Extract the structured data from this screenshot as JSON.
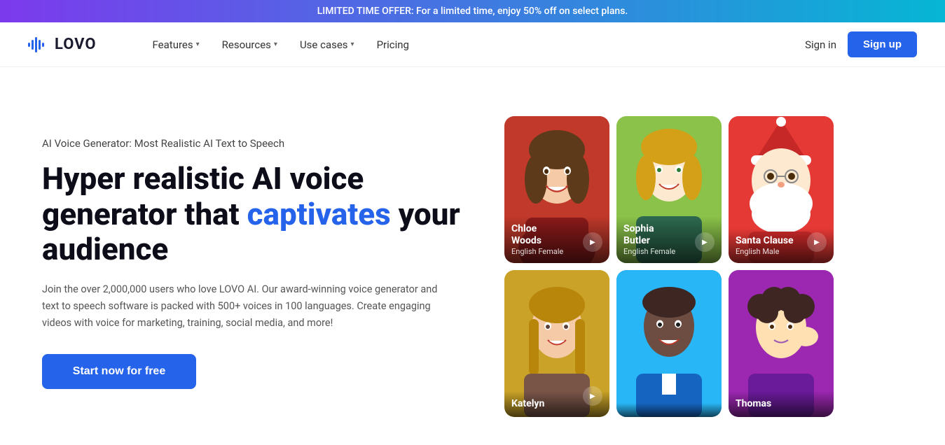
{
  "banner": {
    "text": "LIMITED TIME OFFER: For a limited time, enjoy 50% off on select plans."
  },
  "nav": {
    "logo_text": "LOVO",
    "links": [
      {
        "label": "Features",
        "has_dropdown": true
      },
      {
        "label": "Resources",
        "has_dropdown": true
      },
      {
        "label": "Use cases",
        "has_dropdown": true
      },
      {
        "label": "Pricing",
        "has_dropdown": false
      }
    ],
    "sign_in": "Sign in",
    "sign_up": "Sign up"
  },
  "hero": {
    "subtitle": "AI Voice Generator: Most Realistic AI Text to Speech",
    "title_plain": "Hyper realistic AI voice generator that ",
    "title_highlight": "captivates",
    "title_end": " your audience",
    "description": "Join the over 2,000,000 users who love LOVO AI. Our award-winning voice generator and text to speech software is packed with 500+ voices in 100 languages. Create engaging videos with voice for marketing, training, social media, and more!",
    "cta": "Start now for free"
  },
  "voices": [
    {
      "id": "chloe",
      "name": "Chloe\nWoods",
      "lang": "English Female",
      "bg_color": "#b5451b",
      "position": 1
    },
    {
      "id": "sophia",
      "name": "Sophia Butler",
      "lang": "English Female",
      "bg_color": "#8bc34a",
      "position": 2
    },
    {
      "id": "santa",
      "name": "Santa Clause",
      "lang": "English Male",
      "bg_color": "#d32f2f",
      "position": 3
    },
    {
      "id": "katelyn",
      "name": "Katelyn",
      "lang": "",
      "bg_color": "#c9a227",
      "position": 4
    },
    {
      "id": "blackman",
      "name": "",
      "lang": "",
      "bg_color": "#1565c0",
      "position": 5
    },
    {
      "id": "thomas",
      "name": "Thomas",
      "lang": "",
      "bg_color": "#7b1fa2",
      "position": 6
    }
  ]
}
